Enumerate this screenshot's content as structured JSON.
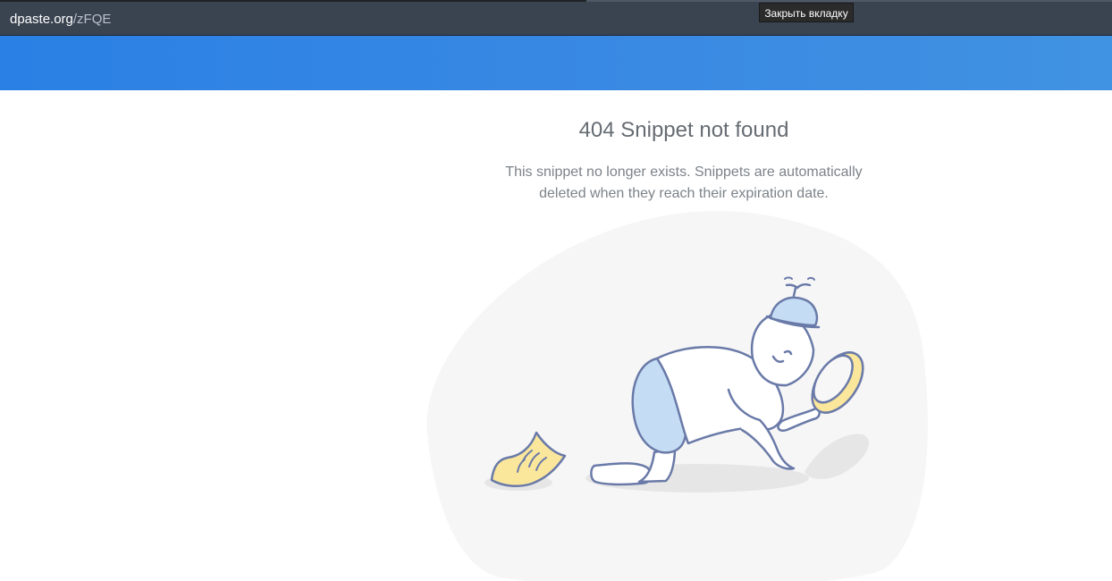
{
  "browser": {
    "url_domain": "dpaste.org",
    "url_path": "/zFQE",
    "tooltip": "Закрыть вкладку"
  },
  "colors": {
    "topbar": "#3a4350",
    "banner": "#2a80e4",
    "blob": "#f6f6f6",
    "figure_stroke": "#6a7aa8",
    "shorts": "#c5ddf4",
    "paper": "#fbe79b"
  },
  "page": {
    "title": "404 Snippet not found",
    "description_line1": "This snippet no longer exists. Snippets are automatically",
    "description_line2": "deleted when they reach their expiration date."
  },
  "illustration": {
    "icons": [
      "searching-person-icon",
      "magnifier-icon",
      "paper-note-icon",
      "propeller-cap-icon"
    ]
  }
}
